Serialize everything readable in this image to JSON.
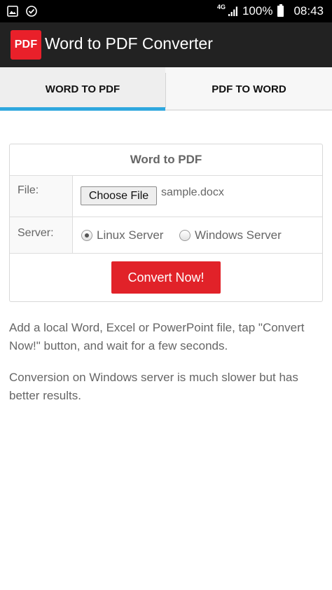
{
  "status_bar": {
    "network_type": "4G",
    "battery_level": "100%",
    "time": "08:43",
    "icons": [
      "gallery-icon",
      "shield-check-icon",
      "signal-icon",
      "battery-icon"
    ]
  },
  "app_bar": {
    "logo_text": "PDF",
    "title": "Word to PDF Converter"
  },
  "tabs": [
    {
      "label": "WORD TO PDF",
      "active": true
    },
    {
      "label": "PDF TO WORD",
      "active": false
    }
  ],
  "form": {
    "title": "Word to PDF",
    "file_label": "File:",
    "choose_file_label": "Choose File",
    "file_name": "sample.docx",
    "server_label": "Server:",
    "server_options": [
      {
        "label": "Linux Server",
        "selected": true
      },
      {
        "label": "Windows Server",
        "selected": false
      }
    ],
    "convert_label": "Convert Now!"
  },
  "instructions": [
    "Add a local Word, Excel or PowerPoint file, tap \"Convert Now!\" button, and wait for a few seconds.",
    "Conversion on Windows server is much slower but has better results."
  ],
  "colors": {
    "accent_red": "#e12229",
    "tab_indicator": "#2fa7de",
    "app_bar": "#222222"
  }
}
